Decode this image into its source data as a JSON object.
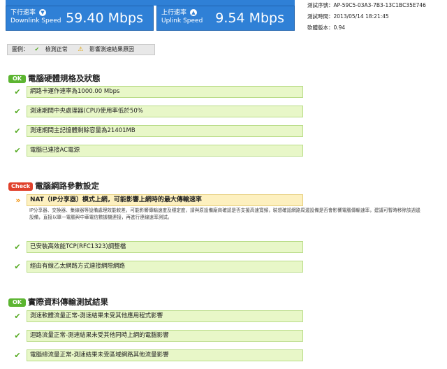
{
  "speed": {
    "downlink_label_zh": "下行速率",
    "downlink_label_en": "Downlink Speed",
    "downlink_value": "59.40 Mbps",
    "uplink_label_zh": "上行速率",
    "uplink_label_en": "Uplink Speed",
    "uplink_value": "9.54 Mbps"
  },
  "test_info": {
    "serial": "測試序號：AP-59C5-03A3-7B3-13C1BC35E746",
    "time": "測試時間：2013/05/14 18:21:45",
    "version": "軟體版本：0.94"
  },
  "legend": {
    "title": "圖例：",
    "normal": "檢測正常",
    "affects": "影響測速結果原因"
  },
  "sections": {
    "hardware": {
      "badge": "OK",
      "title": "電腦硬體規格及狀態",
      "items": [
        "網路卡運作速率為1000.00 Mbps",
        "測速期間中央處理器(CPU)使用率低於50%",
        "測速期間主記憶體剩餘容量為21401MB",
        "電腦已連接AC電源"
      ]
    },
    "network": {
      "badge": "Check",
      "title": "電腦網路參數設定",
      "warning": "NAT（IP分享器）模式上網，可能影響上網時的最大傳輸速率",
      "note": "IP分享器、交換器、集線器等設備處理效能較差，可能影響傳輸速度及穩定度，請與原設備廠商確認是否支援高速寬頻，裝想確認網路周邊設備是否會影響電腦傳輸速率，建議可暫時移除該週邊設備，直接以單一電腦與中華電信數據機連接，再進行連線速率測試。",
      "items": [
        "已安裝高效能TCP(RFC1323)調整檔",
        "經由有線乙太網路方式連接網際網路"
      ]
    },
    "transfer": {
      "badge": "OK",
      "title": "實際資料傳輸測試結果",
      "items": [
        "測速軟體流量正常-測速結果未受其他應用程式影響",
        "迴路流量正常-測速結果未受其他同時上網的電腦影響",
        "電腦總流量正常-測速結果未受區域網路其他流量影響"
      ]
    }
  }
}
